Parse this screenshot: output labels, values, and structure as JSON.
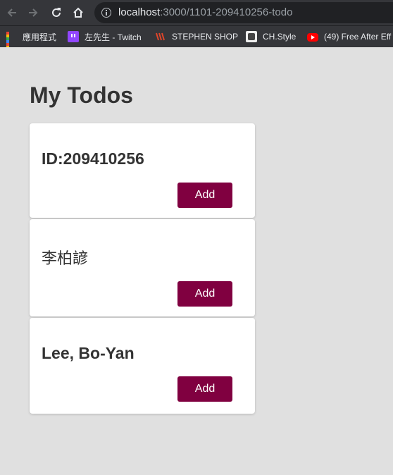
{
  "browser": {
    "url_host": "localhost",
    "url_path": ":3000/1101-209410256-todo",
    "bookmarks": [
      {
        "label": "應用程式",
        "icon": "apps-grid-icon"
      },
      {
        "label": "左先生 - Twitch",
        "icon": "twitch-icon"
      },
      {
        "label": "STEPHEN SHOP",
        "icon": "stephen-shop-icon"
      },
      {
        "label": "CH.Style",
        "icon": "ch-style-icon"
      },
      {
        "label": "(49) Free After Eff",
        "icon": "youtube-icon"
      }
    ]
  },
  "page": {
    "title": "My Todos",
    "todos": [
      {
        "text": "ID:209410256",
        "button": "Add"
      },
      {
        "text": "李柏諺",
        "button": "Add"
      },
      {
        "text": "Lee, Bo-Yan",
        "button": "Add"
      }
    ]
  },
  "colors": {
    "accent": "#800040",
    "background": "#e0e0e0",
    "card": "#ffffff",
    "text": "#333333"
  }
}
